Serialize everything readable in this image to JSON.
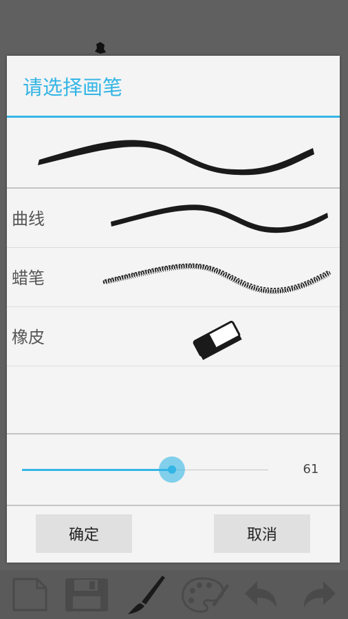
{
  "dialog": {
    "title": "请选择画笔",
    "brushes": [
      {
        "label": "曲线",
        "icon": "curve-stroke-icon"
      },
      {
        "label": "蜡笔",
        "icon": "crayon-stroke-icon"
      },
      {
        "label": "橡皮",
        "icon": "eraser-icon"
      }
    ],
    "size_slider": {
      "value": "61",
      "fraction": 0.61
    },
    "confirm_label": "确定",
    "cancel_label": "取消"
  },
  "toolbar": {
    "icons": [
      "new-page-icon",
      "save-icon",
      "brush-icon",
      "palette-icon",
      "undo-icon",
      "redo-icon"
    ]
  },
  "colors": {
    "accent": "#33b5e5",
    "dialog_bg": "#f4f4f4",
    "toolbar_bg": "#5a5a5a",
    "button_bg": "#e0e0e0"
  }
}
